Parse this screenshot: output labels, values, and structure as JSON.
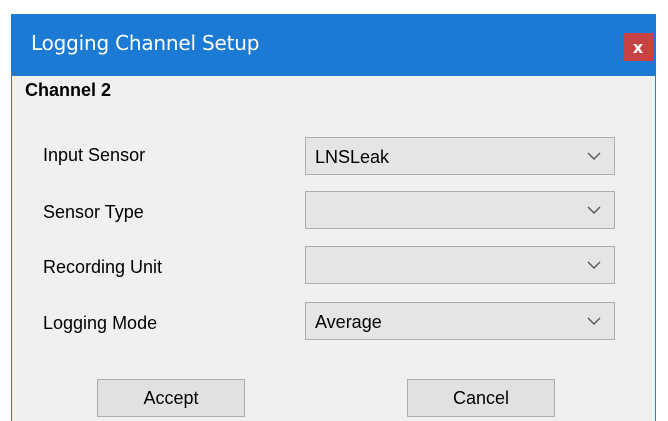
{
  "window": {
    "title": "Logging Channel Setup",
    "close_glyph": "x"
  },
  "section": {
    "title": "Channel 2"
  },
  "fields": [
    {
      "label": "Input Sensor",
      "value": "LNSLeak"
    },
    {
      "label": "Sensor Type",
      "value": ""
    },
    {
      "label": "Recording Unit",
      "value": ""
    },
    {
      "label": "Logging Mode",
      "value": "Average"
    }
  ],
  "buttons": {
    "accept": "Accept",
    "cancel": "Cancel"
  },
  "colors": {
    "titlebar": "#1a7ad4",
    "close": "#c74343",
    "dialog_bg": "#f0f0f0"
  },
  "icons": {
    "close": "close-icon",
    "dropdown": "chevron-down-icon"
  }
}
